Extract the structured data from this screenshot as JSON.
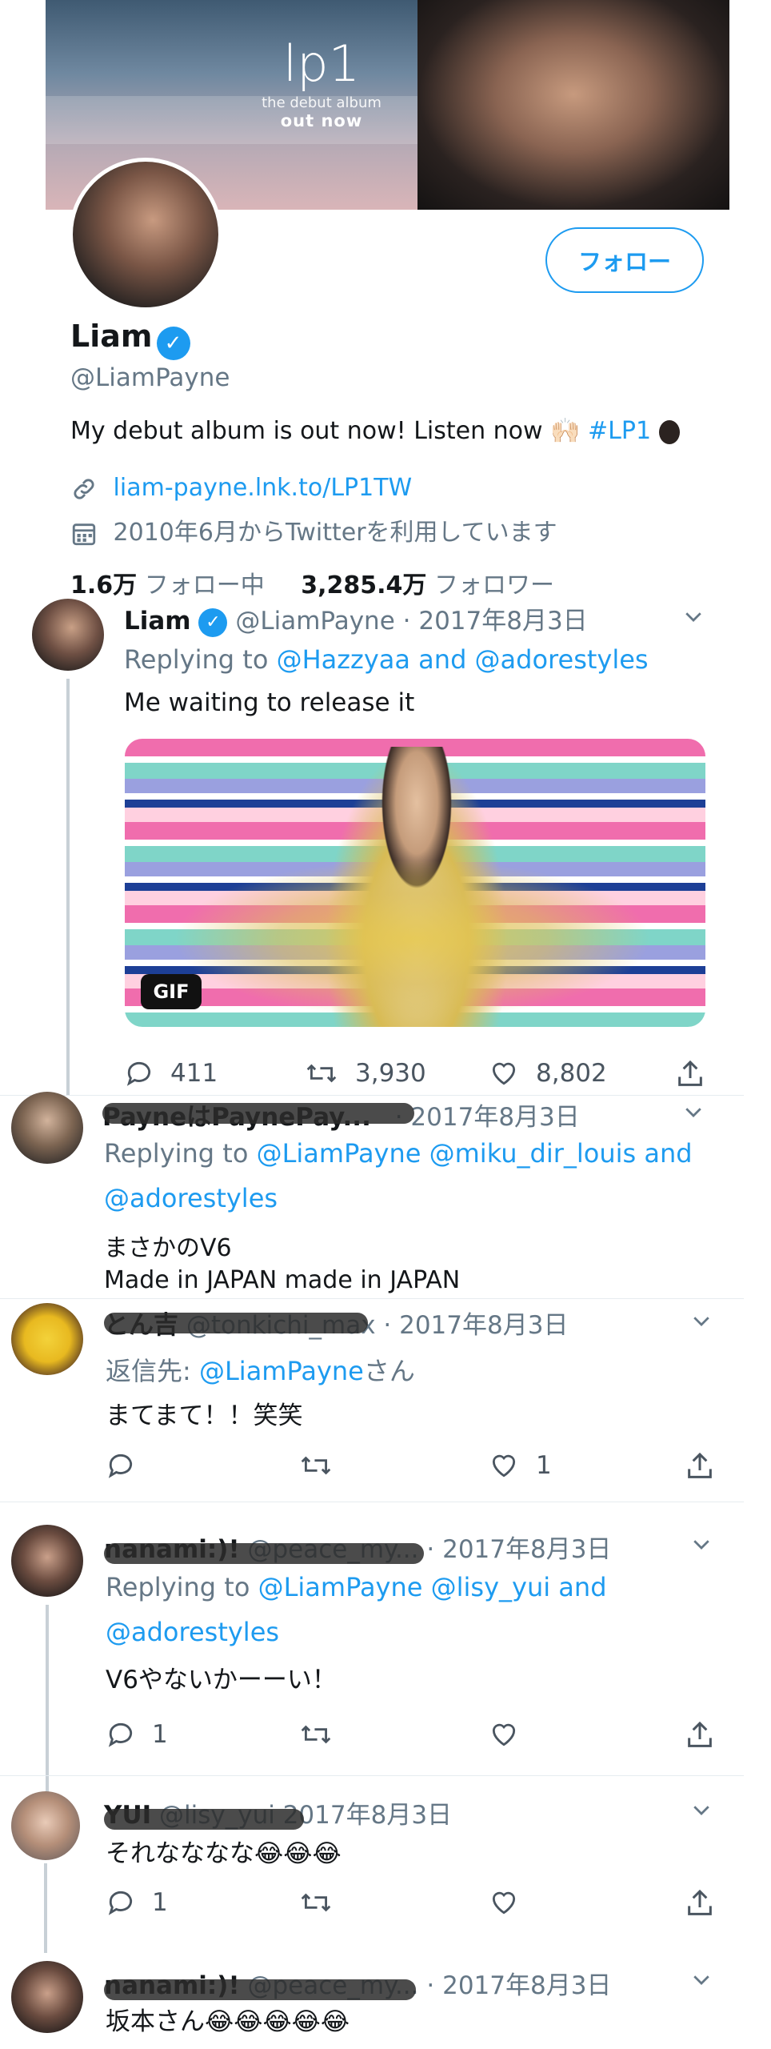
{
  "profile": {
    "banner_title": "lp1",
    "banner_sub1": "the debut album",
    "banner_sub2": "out now",
    "follow_label": "フォロー",
    "name": "Liam",
    "handle": "@LiamPayne",
    "bio_text": "My debut album is out now! Listen now",
    "bio_emoji": "🙌🏻",
    "bio_hashtag": "#LP1",
    "link": "liam-payne.lnk.to/LP1TW",
    "joined": "2010年6月からTwitterを利用しています",
    "following_count": "1.6万",
    "following_label": "フォロー中",
    "followers_count": "3,285.4万",
    "followers_label": "フォロワー"
  },
  "tweet1": {
    "name": "Liam",
    "handle": "@LiamPayne",
    "date": "· 2017年8月3日",
    "replying_prefix": "Replying to",
    "replying_to": "@Hazzyaa and @adorestyles",
    "text": "Me waiting to release it",
    "gif_label": "GIF",
    "replies": "411",
    "retweets": "3,930",
    "likes": "8,802"
  },
  "tweet2": {
    "name": "PayneはPaynePay...",
    "date": "· 2017年8月3日",
    "replying_prefix": "Replying to",
    "replying_to_line1": "@LiamPayne @miku_dir_louis and",
    "replying_to_line2": "@adorestyles",
    "text_line1": "まさかのV6",
    "text_line2": "Made in JAPAN made in JAPAN"
  },
  "tweet3": {
    "name": "とん吉",
    "handle": "@tonkichi_max",
    "date": "· 2017年8月3日",
    "replying_prefix": "返信先:",
    "replying_to": "@LiamPayne",
    "replying_suffix": "さん",
    "text": "まてまて！！笑笑",
    "likes": "1"
  },
  "tweet4": {
    "name": "nanami:)!",
    "handle": "@peace_my...",
    "date": "· 2017年8月3日",
    "replying_prefix": "Replying to",
    "replying_to_line1": "@LiamPayne @lisy_yui and",
    "replying_to_line2": "@adorestyles",
    "text": "V6やないかーーい！",
    "replies": "1"
  },
  "tweet5": {
    "name": "YUI",
    "handle": "@lisy_yui",
    "date": "2017年8月3日",
    "text": "それなななな😂😂😂",
    "replies": "1"
  },
  "tweet6": {
    "name": "nanami:)!",
    "handle": "@peace_my...",
    "date": "· 2017年8月3日",
    "text": "坂本さん😂😂😂😂😂"
  },
  "colors": {
    "accent": "#1d9bf0",
    "text": "#14171a",
    "muted": "#657786"
  }
}
